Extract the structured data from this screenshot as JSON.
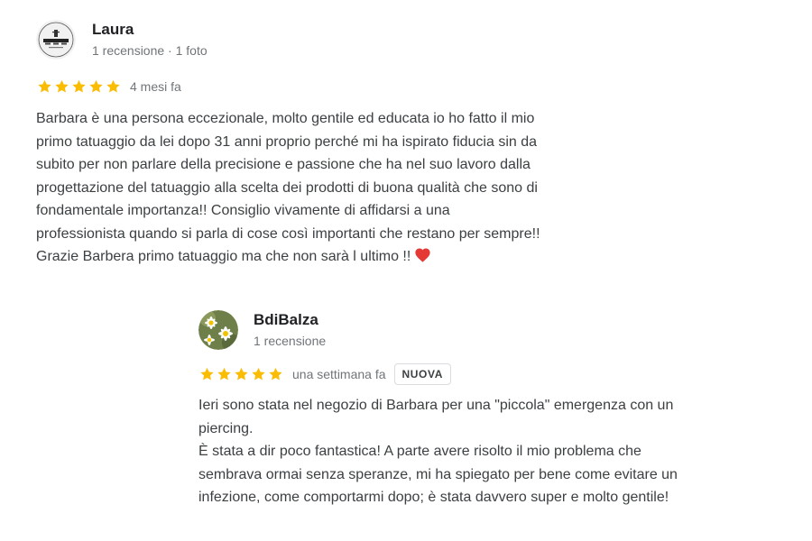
{
  "reviews": [
    {
      "author": "Laura",
      "meta": "1 recensione · 1 foto",
      "rating": 5,
      "when": "4 mesi fa",
      "badge": "",
      "text_lines": [
        "Barbara è una persona eccezionale, molto gentile ed educata io ho fatto il mio",
        "primo tatuaggio da lei dopo 31 anni proprio perché mi ha ispirato fiducia sin da",
        "subito per non parlare della precisione e passione che ha nel suo lavoro dalla",
        "progettazione del tatuaggio alla scelta dei prodotti di buona qualità che sono di",
        "fondamentale importanza!! Consiglio vivamente di affidarsi a una",
        "professionista quando si parla di cose così importanti che restano per sempre!!",
        "Grazie Barbera primo tatuaggio ma che non sarà l ultimo !!"
      ],
      "trailing_emoji": "heart-emoji",
      "avatar_icon": "tattoo-shop-avatar"
    },
    {
      "author": "BdiBalza",
      "meta": "1 recensione",
      "rating": 5,
      "when": "una settimana fa",
      "badge": "NUOVA",
      "text_lines": [
        "Ieri sono stata nel negozio di Barbara per una \"piccola\" emergenza con un",
        "piercing.",
        "È stata a dir poco fantastica! A parte avere risolto il mio problema che",
        "sembrava ormai senza speranze, mi ha spiegato per bene come evitare un",
        "infezione, come comportarmi dopo; è stata davvero super e molto gentile!"
      ],
      "avatar_icon": "daisy-flowers-avatar"
    }
  ],
  "colors": {
    "star": "#fbbc04",
    "heart": "#e53935",
    "meta_text": "#70757a",
    "body_text": "#3c4043"
  }
}
